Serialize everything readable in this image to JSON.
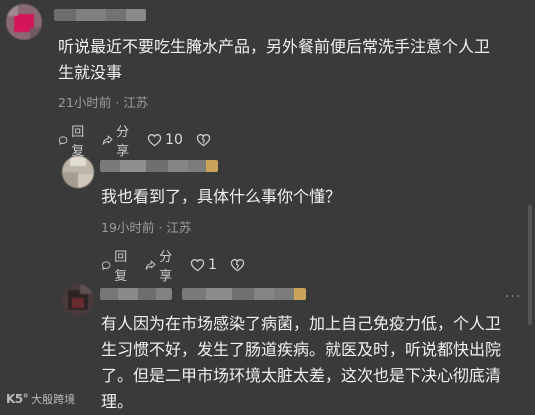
{
  "comments": [
    {
      "text": "听说最近不要吃生腌水产品，另外餐前便后常洗手注意个人卫\n生就没事",
      "meta": "21小时前 · 江苏",
      "reply_label": "回复",
      "share_label": "分享",
      "like_count": "10"
    },
    {
      "text": "我也看到了，具体什么事你个懂？",
      "meta": "19小时前 · 江苏",
      "reply_label": "回复",
      "share_label": "分享",
      "like_count": "1"
    },
    {
      "text": "有人因为在市场感染了病菌，加上自己免疫力低，个人卫\n生习惯不好，发生了肠道疾病。就医及时，听说都快出院\n了。但是二甲市场环境太脏太差，这次也是下决心彻底清\n理。",
      "more": "···"
    }
  ],
  "watermark": {
    "logo": "K5°",
    "text": "大殷跨境"
  },
  "colors": {
    "background": "#3a3a3a",
    "text": "#f0f0f0",
    "meta": "#9c9c9c"
  }
}
